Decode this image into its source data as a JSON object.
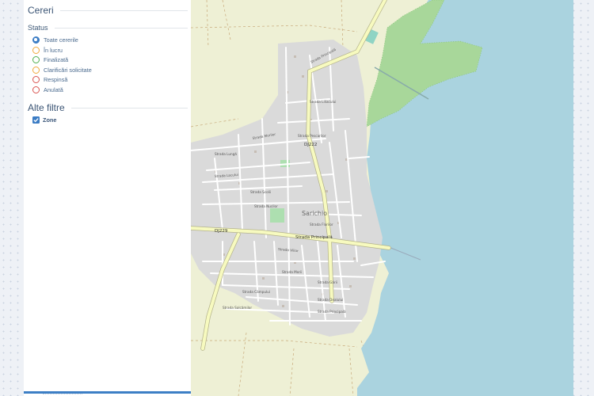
{
  "panel": {
    "title": "Cereri",
    "status_heading": "Status",
    "status_options": [
      {
        "label": "Toate cererile",
        "color": "#3b7cc4",
        "checked": true
      },
      {
        "label": "În lucru",
        "color": "#f0a93b",
        "checked": false
      },
      {
        "label": "Finalizată",
        "color": "#4cae4c",
        "checked": false
      },
      {
        "label": "Clarificări solicitate",
        "color": "#f0a93b",
        "checked": false
      },
      {
        "label": "Respinsă",
        "color": "#d9534f",
        "checked": false
      },
      {
        "label": "Anulată",
        "color": "#d9534f",
        "checked": false
      }
    ],
    "filters_heading": "Alte filtre",
    "filters": [
      {
        "label": "Zone",
        "checked": true,
        "color": "#3b7cc4"
      }
    ]
  },
  "map": {
    "village_label": "Sarichio",
    "road_labels": {
      "dj222": "DJ222",
      "dj229": "DJ229",
      "principala_n": "Strada Principală",
      "principala_c": "Strada Principală",
      "principala_w": "Strada Principală",
      "liliacului": "Strada Liliacului",
      "morilor": "Strada Morilor",
      "pescarilor": "Strada Pescarilor",
      "lunga": "Strada Lungă",
      "lacului": "Strada Lacului",
      "scolii": "Strada Școlii",
      "nucilor": "Strada Nucilor",
      "florilor": "Strada Florilor",
      "viilor": "Strada Viilor",
      "morii": "Strada Morii",
      "garii": "Strada Gării",
      "campului": "Strada Câmpului",
      "dealului": "Strada Dealului",
      "salcamilor": "Strada Salcâmilor"
    },
    "colors": {
      "land": "#f0efe6",
      "farmland": "#eef0d5",
      "water": "#aad3df",
      "residential": "#dadada",
      "marsh": "#a8d79a",
      "major_road": "#f7fabf",
      "major_road_casing": "#b4b38c",
      "minor_road": "#ffffff",
      "park": "#addfb0"
    }
  }
}
